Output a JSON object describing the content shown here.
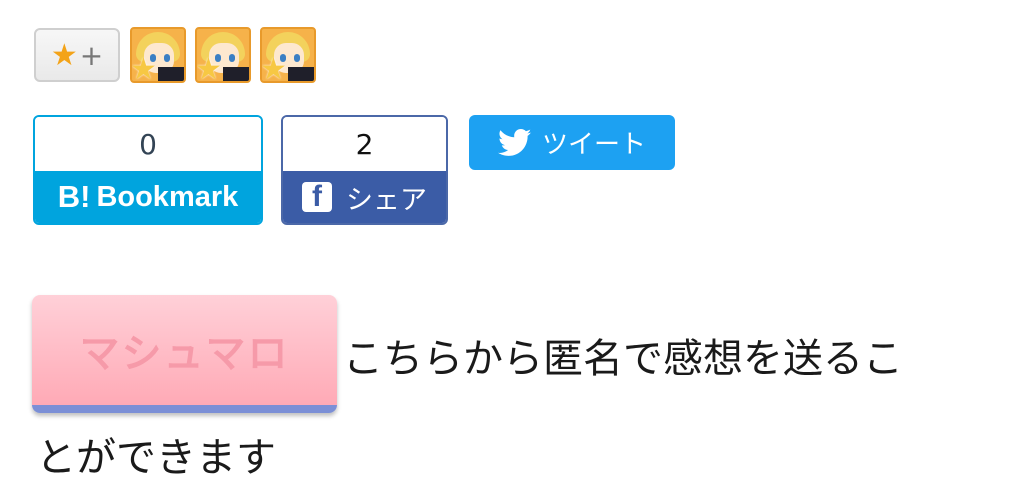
{
  "star": {
    "star_glyph": "★",
    "plus_glyph": "+"
  },
  "avatars": [
    {
      "icon": "user-avatar-icon"
    },
    {
      "icon": "user-avatar-icon"
    },
    {
      "icon": "user-avatar-icon"
    }
  ],
  "hatena": {
    "count": "0",
    "logo": "B!",
    "label": "Bookmark",
    "color": "#00a4de"
  },
  "facebook": {
    "count": "2",
    "logo": "f",
    "label": "シェア",
    "color": "#3b5ca6"
  },
  "twitter": {
    "label": "ツイート",
    "color": "#1da1f2"
  },
  "marshmallow": {
    "button_label": "マシュマロ",
    "text_line1": "こちらから匿名で感想を送るこ",
    "text_line2": "とができます"
  }
}
